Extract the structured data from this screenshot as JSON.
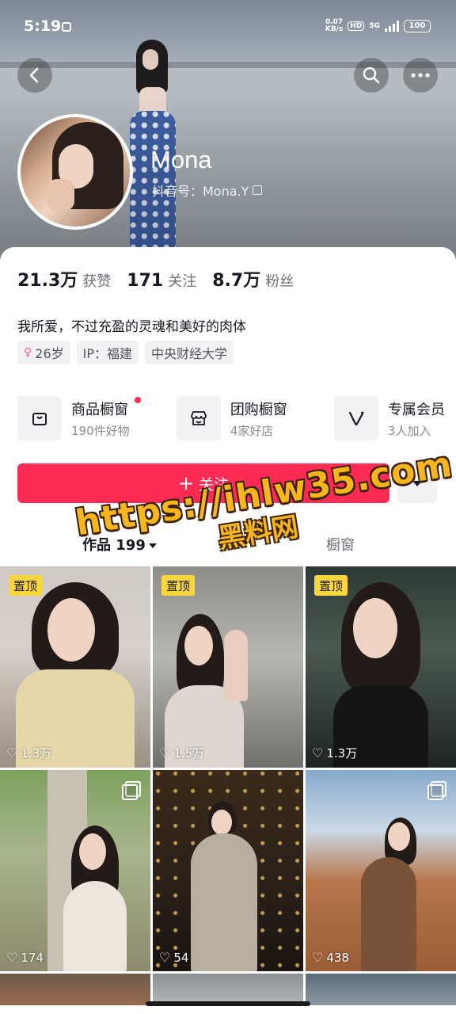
{
  "status_bar": {
    "time": "5:19",
    "net_speed_value": "0.07",
    "net_speed_unit": "KB/s",
    "hd": "HD",
    "network": "5G",
    "battery": "100"
  },
  "header": {
    "back_icon": "chevron-left-icon",
    "search_icon": "search-icon",
    "more_icon": "more-dots-icon"
  },
  "profile": {
    "name": "Mona",
    "douyin_id": "抖音号：Mona.Y"
  },
  "stats": [
    {
      "value": "21.3万",
      "label": "获赞"
    },
    {
      "value": "171",
      "label": "关注"
    },
    {
      "value": "8.7万",
      "label": "粉丝"
    }
  ],
  "bio": "我所爱，不过充盈的灵魂和美好的肉体",
  "tags": {
    "age": "26岁",
    "ip": "IP：福建",
    "school": "中央财经大学"
  },
  "features": [
    {
      "title": "商品橱窗",
      "sub": "190件好物",
      "icon": "shopping-bag-icon"
    },
    {
      "title": "团购橱窗",
      "sub": "4家好店",
      "icon": "storefront-icon"
    },
    {
      "title": "专属会员",
      "sub": "3人加入",
      "icon": "v-membership-icon"
    }
  ],
  "actions": {
    "follow_label": "关注"
  },
  "tabs": {
    "works": "作品 199",
    "shop": "橱窗"
  },
  "grid": [
    {
      "likes": "1.3万",
      "pinned": "置顶"
    },
    {
      "likes": "1.5万",
      "pinned": "置顶"
    },
    {
      "likes": "1.3万",
      "pinned": "置顶"
    },
    {
      "likes": "174",
      "multi": true
    },
    {
      "likes": "54"
    },
    {
      "likes": "438",
      "multi": true
    }
  ],
  "watermark": {
    "url": "https://ihlw35.com",
    "text": "黑料网"
  }
}
